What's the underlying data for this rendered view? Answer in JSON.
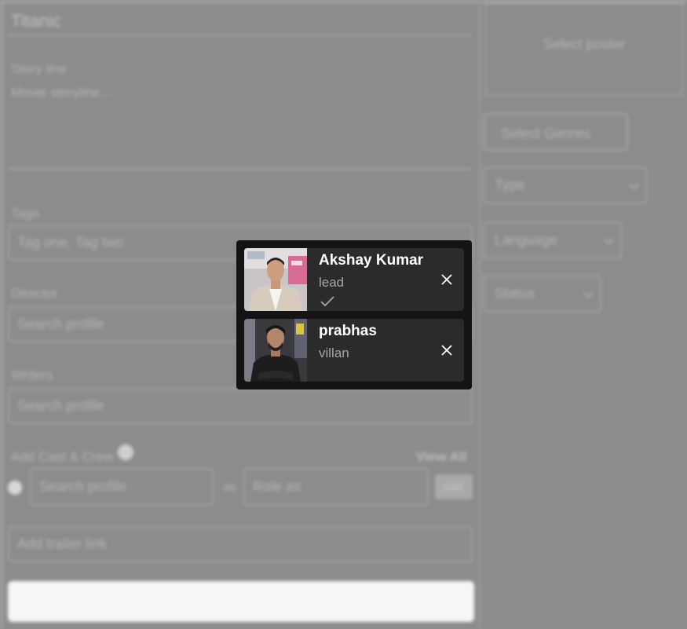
{
  "form": {
    "title_placeholder": "Titanic",
    "storyline_label": "Story line",
    "storyline_placeholder": "Movie storyline...",
    "tags_label": "Tags",
    "tags_placeholder": "Tag one, Tag two",
    "director_label": "Director",
    "director_placeholder": "Search profile",
    "writers_label": "Writers",
    "writers_placeholder": "Search profile",
    "cast_label": "Add Cast & Crew",
    "view_all_label": "View All",
    "cast_search_placeholder": "Search profile",
    "as_label": "as",
    "role_placeholder": "Role as",
    "add_label": "Add",
    "trailer_placeholder": "Add trailer link"
  },
  "sidebar": {
    "poster_label": "Select poster",
    "genres_button_label": "Select Genres",
    "type_select": "Type",
    "language_select": "Language",
    "status_select": "Status"
  },
  "cast_popup": {
    "members": [
      {
        "name": "Akshay Kumar",
        "role": "lead",
        "lead_checked": true
      },
      {
        "name": "prabhas",
        "role": "villan",
        "lead_checked": false
      }
    ]
  },
  "colors": {
    "overlay_bg": "#141414",
    "card_bg": "#2b2b2b",
    "name_text": "#ffffff",
    "role_text": "#a6a6a6"
  }
}
